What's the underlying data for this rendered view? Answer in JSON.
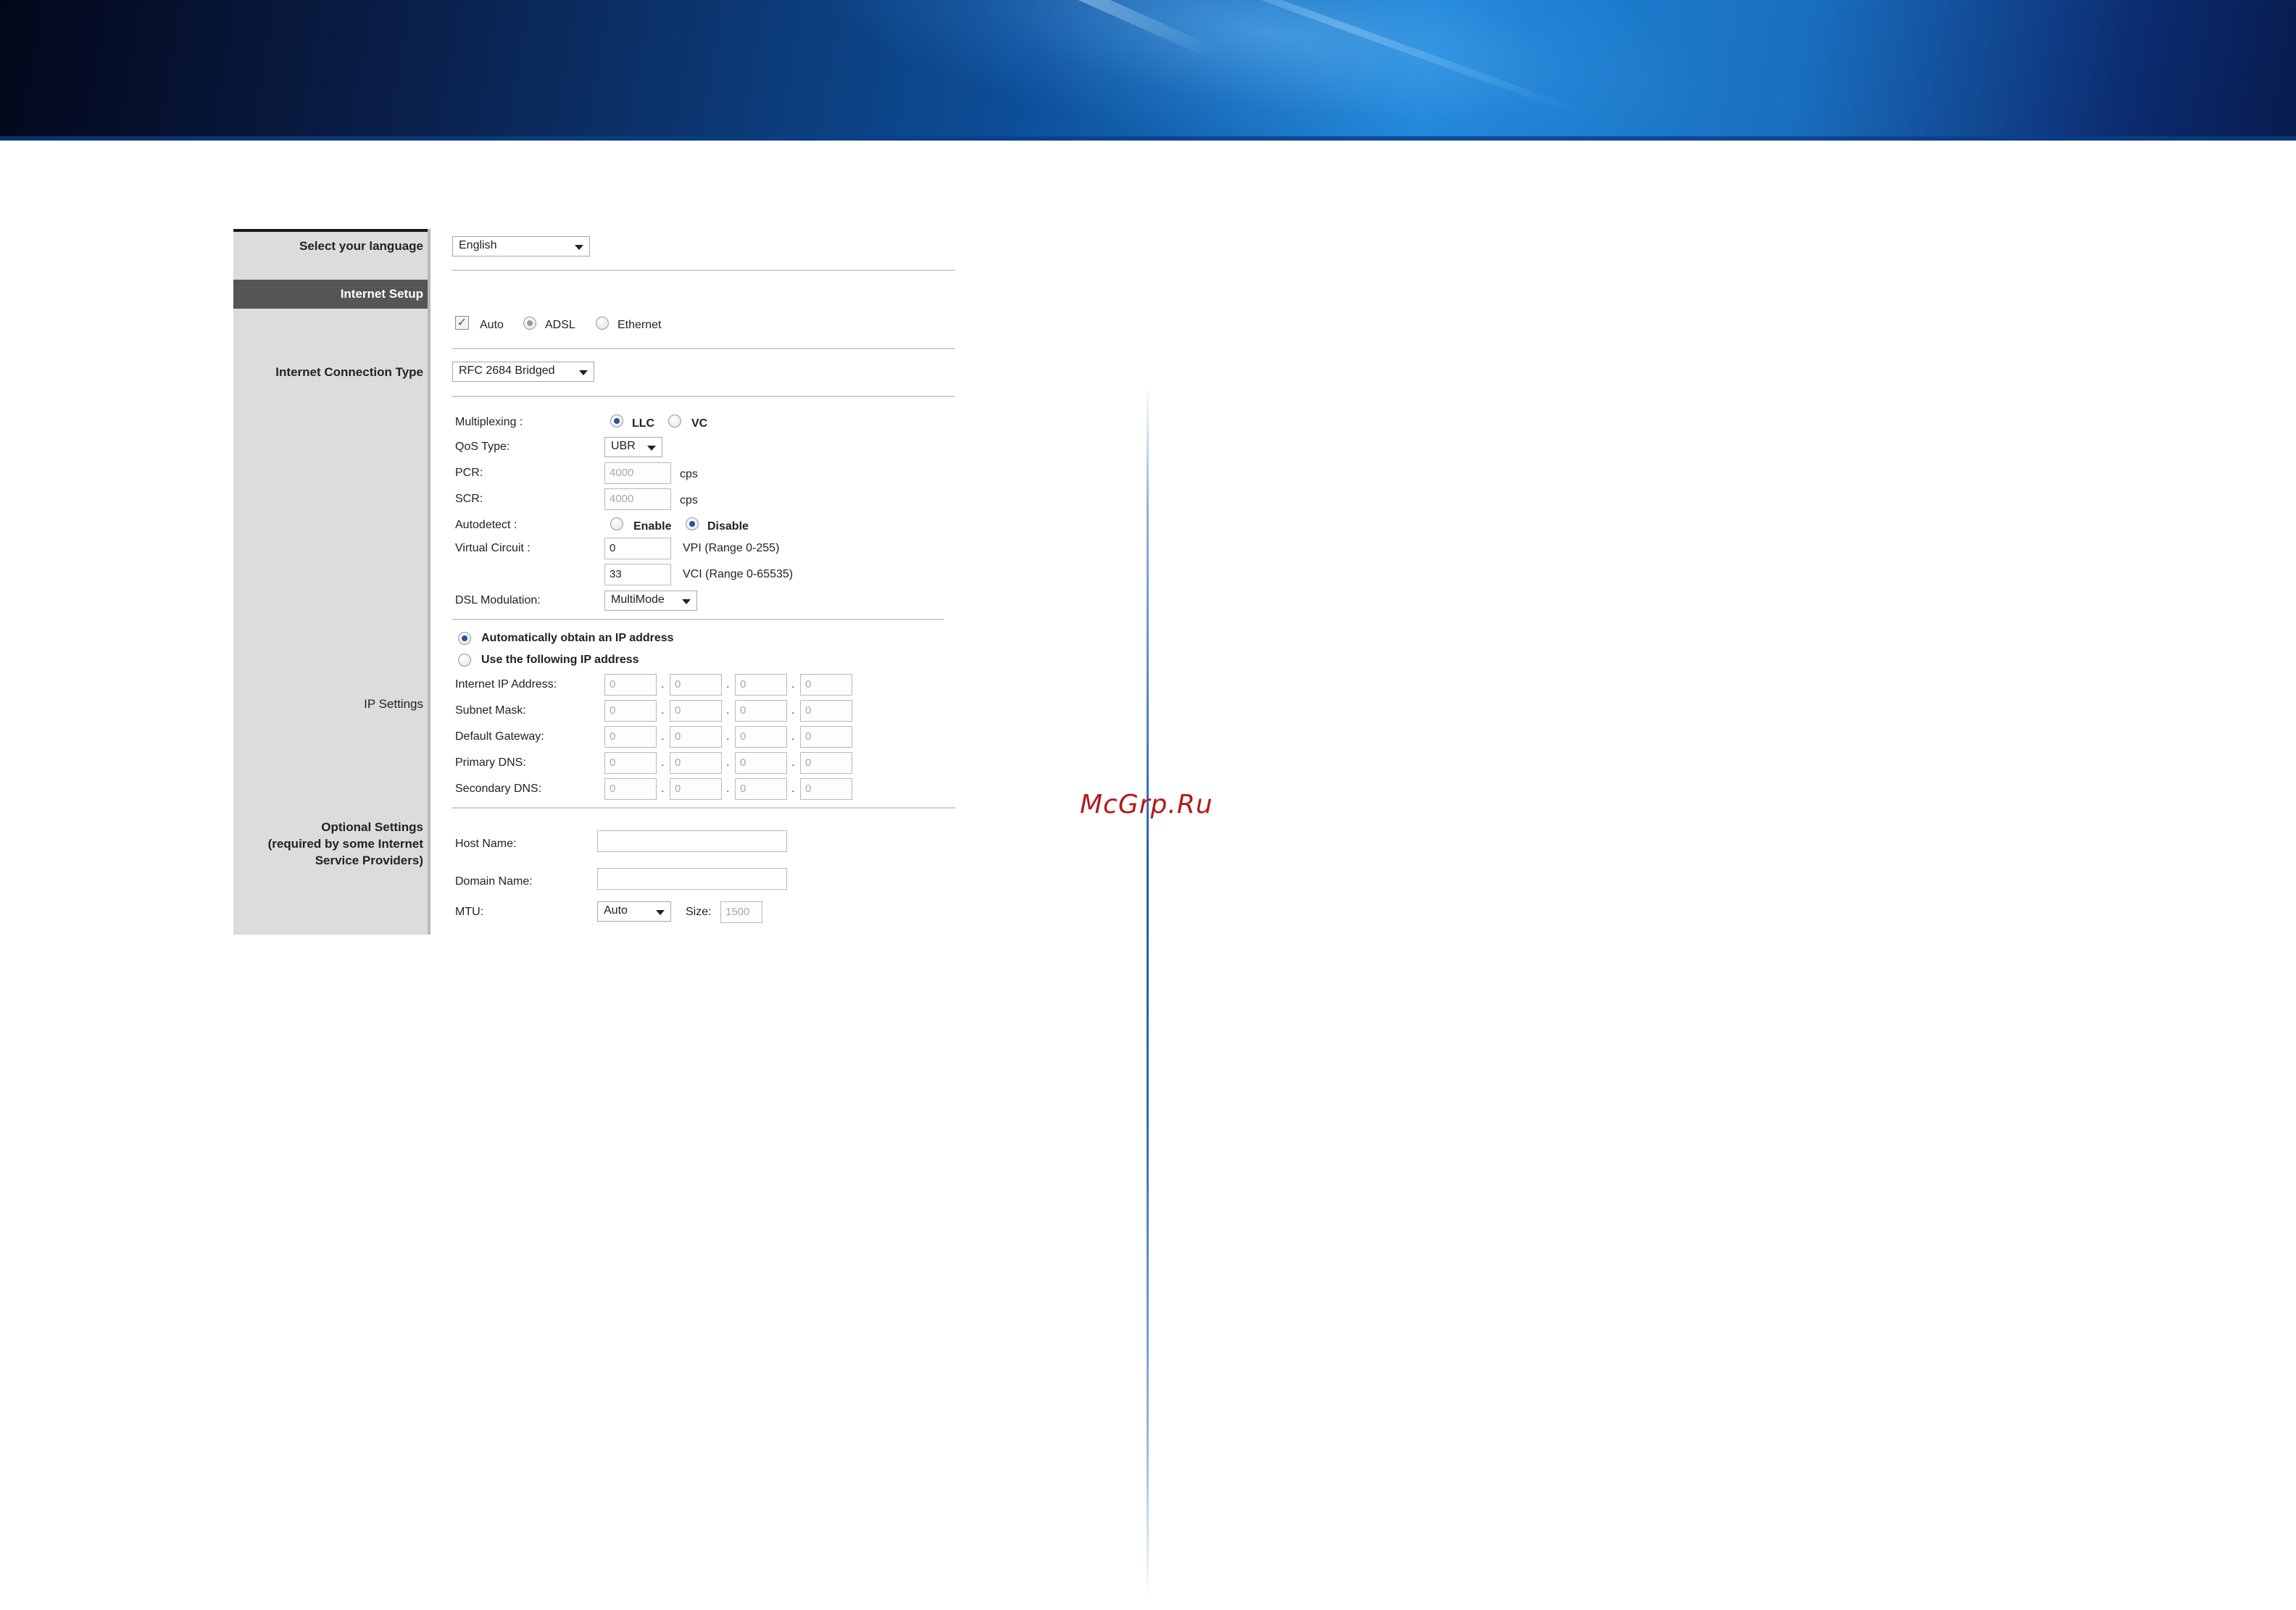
{
  "watermark": "McGrp.Ru",
  "colors": {
    "banner": "#0d4f9a",
    "selected_radio": "#2a4fa0",
    "label_panel": "#dcdcdc",
    "section_header": "#555555"
  },
  "labels": {
    "language": "Select your language",
    "internet_setup": "Internet Setup",
    "connection_type": "Internet Connection Type",
    "ip_settings": "IP Settings",
    "optional_line1": "Optional Settings",
    "optional_line2": "(required by some Internet",
    "optional_line3": "Service Providers)"
  },
  "language": {
    "value": "English"
  },
  "mode": {
    "auto": "Auto",
    "adsl": "ADSL",
    "ethernet": "Ethernet",
    "auto_checked": true,
    "selected": "ADSL"
  },
  "connection_type": {
    "value": "RFC 2684 Bridged"
  },
  "atm": {
    "multiplexing_label": "Multiplexing :",
    "llc": "LLC",
    "vc": "VC",
    "qos_label": "QoS Type:",
    "qos_value": "UBR",
    "pcr_label": "PCR:",
    "pcr_value": "4000",
    "pcr_unit": "cps",
    "scr_label": "SCR:",
    "scr_value": "4000",
    "scr_unit": "cps",
    "autodetect_label": "Autodetect :",
    "enable": "Enable",
    "disable": "Disable",
    "vc_label": "Virtual Circuit :",
    "vpi_value": "0",
    "vpi_range": "VPI (Range 0-255)",
    "vci_value": "33",
    "vci_range": "VCI (Range 0-65535)",
    "dsl_label": "DSL Modulation:",
    "dsl_value": "MultiMode"
  },
  "ip": {
    "auto_option": "Automatically obtain an IP address",
    "static_option": "Use the following IP address",
    "rows": [
      {
        "label": "Internet IP Address:",
        "octets": [
          "0",
          "0",
          "0",
          "0"
        ]
      },
      {
        "label": "Subnet Mask:",
        "octets": [
          "0",
          "0",
          "0",
          "0"
        ]
      },
      {
        "label": "Default Gateway:",
        "octets": [
          "0",
          "0",
          "0",
          "0"
        ]
      },
      {
        "label": "Primary DNS:",
        "octets": [
          "0",
          "0",
          "0",
          "0"
        ]
      },
      {
        "label": "Secondary DNS:",
        "octets": [
          "0",
          "0",
          "0",
          "0"
        ]
      }
    ]
  },
  "optional": {
    "host_label": "Host Name:",
    "host_value": "",
    "domain_label": "Domain Name:",
    "domain_value": "",
    "mtu_label": "MTU:",
    "mtu_value": "Auto",
    "size_label": "Size:",
    "size_value": "1500"
  }
}
